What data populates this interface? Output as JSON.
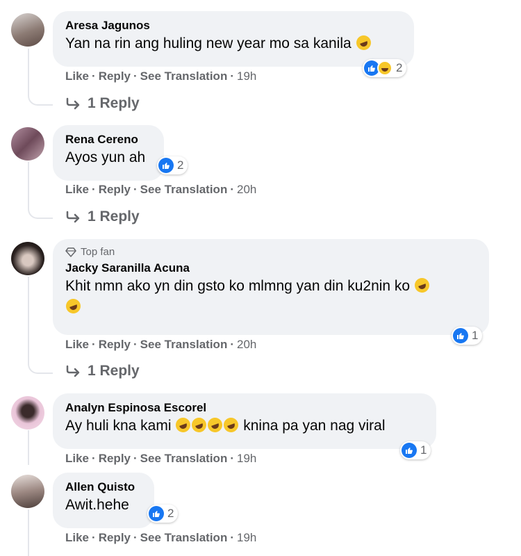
{
  "comments": [
    {
      "name": "Aresa Jagunos",
      "text": "Yan na rin ang huling new year mo sa kanila",
      "like": "Like",
      "reply": "Reply",
      "translate": "See Translation",
      "time": "19h",
      "reaction_count": "2",
      "replies": "1 Reply",
      "emoji": "laughing-tears-icon",
      "reactions": [
        "like-icon",
        "haha-icon"
      ]
    },
    {
      "name": "Rena Cereno",
      "text": "Ayos yun ah",
      "like": "Like",
      "reply": "Reply",
      "translate": "See Translation",
      "time": "20h",
      "reaction_count": "2",
      "replies": "1 Reply",
      "reactions": [
        "like-icon"
      ]
    },
    {
      "badge": "Top fan",
      "name": "Jacky Saranilla Acuna",
      "text": "Khit nmn ako yn din gsto ko mlmng yan din ku2nin ko",
      "like": "Like",
      "reply": "Reply",
      "translate": "See Translation",
      "time": "20h",
      "reaction_count": "1",
      "replies": "1 Reply",
      "emoji": "laughing-tears-icon",
      "reactions": [
        "like-icon"
      ]
    },
    {
      "name": "Analyn Espinosa Escorel",
      "text_before": "Ay huli kna kami",
      "text_after": "knina pa yan nag viral",
      "like": "Like",
      "reply": "Reply",
      "translate": "See Translation",
      "time": "19h",
      "reaction_count": "1",
      "emoji": "rolling-laughing-icon",
      "reactions": [
        "like-icon"
      ]
    },
    {
      "name": "Allen Quisto",
      "text": "Awit.hehe",
      "like": "Like",
      "reply": "Reply",
      "translate": "See Translation",
      "time": "19h",
      "reaction_count": "2",
      "reactions": [
        "like-icon"
      ]
    }
  ],
  "colors": {
    "like_blue": "#1877f2",
    "bubble": "#f0f2f5",
    "meta": "#65676b"
  }
}
